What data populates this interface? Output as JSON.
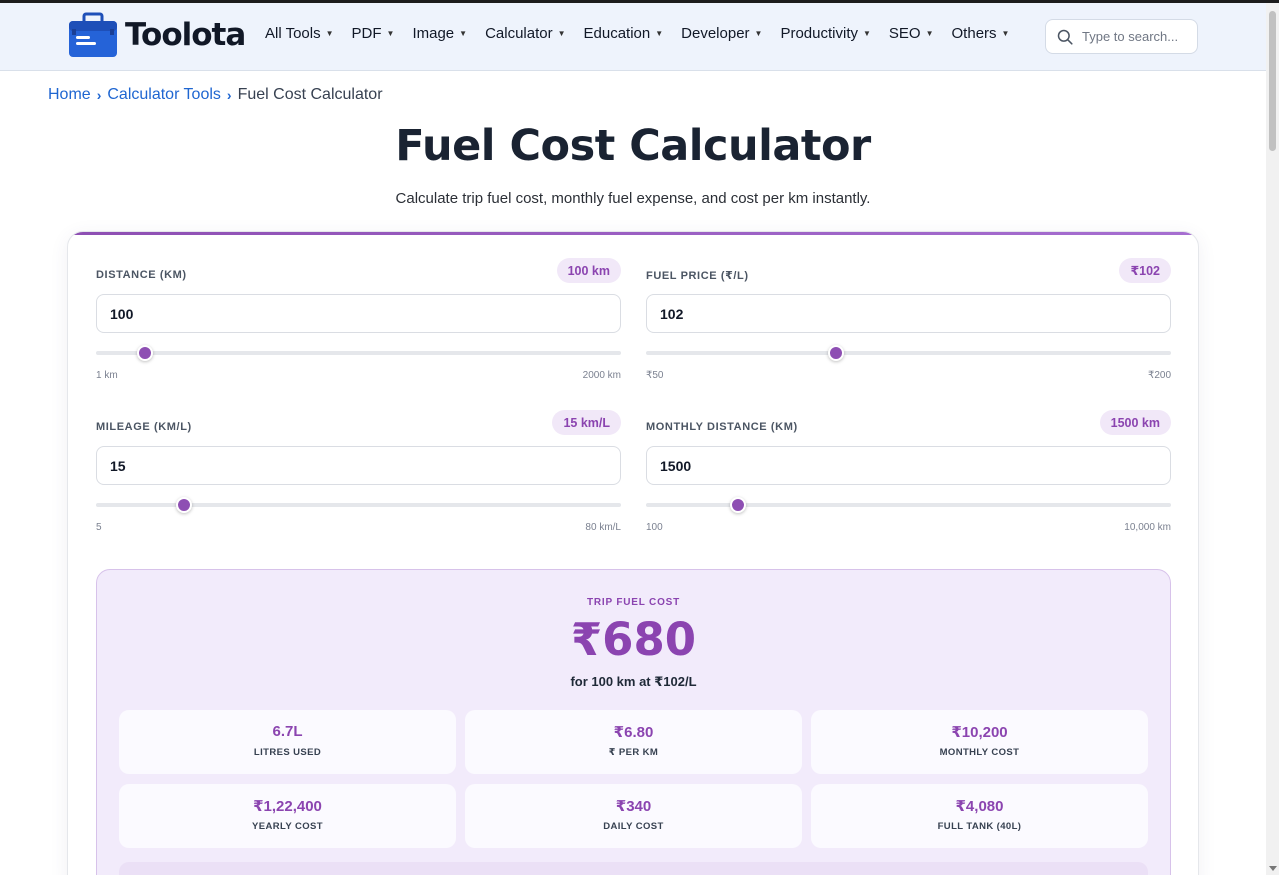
{
  "header": {
    "logo_text": "Toolota",
    "nav": [
      {
        "label": "All Tools"
      },
      {
        "label": "PDF"
      },
      {
        "label": "Image"
      },
      {
        "label": "Calculator"
      },
      {
        "label": "Education"
      },
      {
        "label": "Developer"
      },
      {
        "label": "Productivity"
      },
      {
        "label": "SEO"
      },
      {
        "label": "Others"
      }
    ],
    "search_placeholder": "Type to search..."
  },
  "breadcrumb": {
    "home": "Home",
    "category": "Calculator Tools",
    "current": "Fuel Cost Calculator"
  },
  "page": {
    "title": "Fuel Cost Calculator",
    "subtitle": "Calculate trip fuel cost, monthly fuel expense, and cost per km instantly."
  },
  "fields": {
    "distance": {
      "label": "DISTANCE (KM)",
      "badge": "100 km",
      "value": "100",
      "min_label": "1 km",
      "max_label": "2000 km",
      "min": 1,
      "max": 2000,
      "current": 100
    },
    "fuel_price": {
      "label": "FUEL PRICE (₹/L)",
      "badge": "₹102",
      "value": "102",
      "min_label": "₹50",
      "max_label": "₹200",
      "min": 50,
      "max": 200,
      "current": 102
    },
    "mileage": {
      "label": "MILEAGE (KM/L)",
      "badge": "15 km/L",
      "value": "15",
      "min_label": "5",
      "max_label": "80 km/L",
      "min": 5,
      "max": 80,
      "current": 15
    },
    "monthly_distance": {
      "label": "MONTHLY DISTANCE (KM)",
      "badge": "1500 km",
      "value": "1500",
      "min_label": "100",
      "max_label": "10,000 km",
      "min": 100,
      "max": 10000,
      "current": 1500
    }
  },
  "result": {
    "label": "TRIP FUEL COST",
    "value": "₹680",
    "sub": "for 100 km at ₹102/L",
    "stats": [
      {
        "value": "6.7L",
        "label": "LITRES USED"
      },
      {
        "value": "₹6.80",
        "label": "₹ PER KM"
      },
      {
        "value": "₹10,200",
        "label": "MONTHLY COST"
      },
      {
        "value": "₹1,22,400",
        "label": "YEARLY COST"
      },
      {
        "value": "₹340",
        "label": "DAILY COST"
      },
      {
        "value": "₹4,080",
        "label": "FULL TANK (40L)"
      }
    ]
  },
  "colors": {
    "accent": "#8e4fb3",
    "link": "#1f66d1",
    "logo_blue": "#2563d8"
  }
}
